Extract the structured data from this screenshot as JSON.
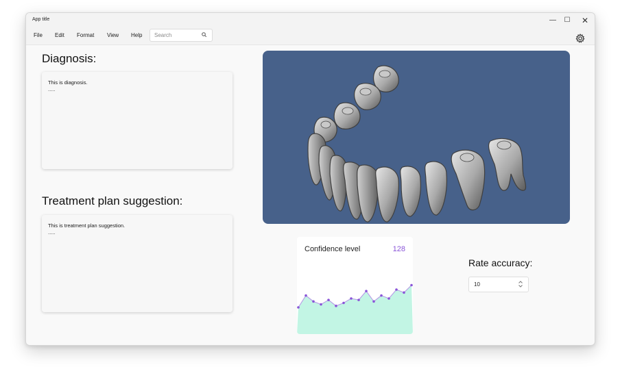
{
  "window": {
    "title": "App title"
  },
  "menu": {
    "items": [
      "File",
      "Edit",
      "Format",
      "View",
      "Help"
    ]
  },
  "search": {
    "placeholder": "Search",
    "icon": "search-icon"
  },
  "settings": {
    "icon": "gear-icon"
  },
  "diagnosis": {
    "heading": "Diagnosis:",
    "line1": "This is diagnosis.",
    "line2": "....."
  },
  "treatment": {
    "heading": "Treatment plan suggestion:",
    "line1": "This is treatment plan suggestion.",
    "line2": "....."
  },
  "confidence": {
    "label": "Confidence level",
    "value": "128",
    "accent_color": "#8a55d8",
    "fill_color": "#c2f5e4"
  },
  "chart_data": {
    "type": "area",
    "values": [
      18,
      26,
      22,
      20,
      23,
      19,
      21,
      24,
      23,
      29,
      22,
      26,
      24,
      30,
      28,
      33
    ]
  },
  "rate": {
    "label": "Rate accuracy:",
    "value": "10"
  },
  "colors": {
    "viewer_background": "#47618a"
  }
}
